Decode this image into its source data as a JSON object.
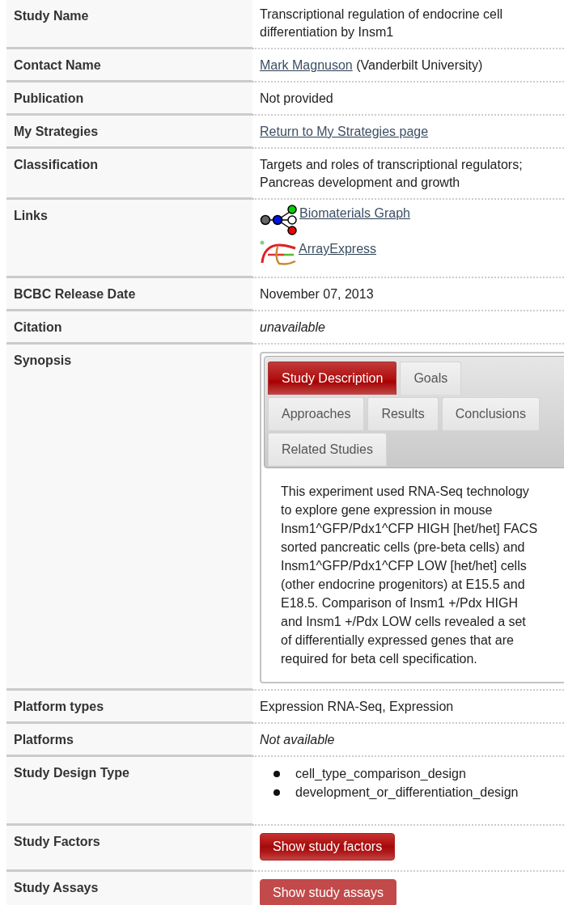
{
  "rows": [
    {
      "label": "Study Name",
      "kind": "text",
      "text": "Transcriptional regulation of endocrine cell differentiation by Insm1"
    },
    {
      "label": "Contact Name",
      "kind": "contact",
      "link": "Mark Magnuson",
      "text": "(Vanderbilt University)"
    },
    {
      "label": "Publication",
      "kind": "text",
      "text": "Not provided"
    },
    {
      "label": "My Strategies",
      "kind": "link",
      "link": "Return to My Strategies page"
    },
    {
      "label": "Classification",
      "kind": "text",
      "text": "Targets and roles of transcriptional regulators; Pancreas development and growth"
    },
    {
      "label": "Links",
      "kind": "links",
      "links": [
        {
          "kind": "graph",
          "text": "Biomaterials Graph"
        },
        {
          "kind": "logo",
          "text": "ArrayExpress"
        }
      ]
    },
    {
      "label": "BCBC Release Date",
      "kind": "text",
      "text": "November 07, 2013"
    },
    {
      "label": "Citation",
      "kind": "italic",
      "text": "unavailable"
    },
    {
      "label": "Synopsis",
      "kind": "synopsis",
      "tabs": [
        {
          "label": "Study Description",
          "selected": true
        },
        {
          "label": "Goals",
          "selected": false
        },
        {
          "label": "Approaches",
          "selected": false
        },
        {
          "label": "Results",
          "selected": false
        },
        {
          "label": "Conclusions",
          "selected": false
        },
        {
          "label": "Related Studies",
          "selected": false
        }
      ],
      "text": "This experiment used RNA-Seq technology to explore gene expression in mouse Insm1^GFP/Pdx1^CFP HIGH [het/het] FACS sorted pancreatic cells (pre-beta cells) and Insm1^GFP/Pdx1^CFP LOW [het/het] cells (other endocrine progenitors) at E15.5 and E18.5. Comparison of Insm1 +/Pdx HIGH and Insm1 +/Pdx LOW cells revealed a set of differentially expressed genes that are required for beta cell specification."
    },
    {
      "label": "Platform types",
      "kind": "text",
      "text": "Expression RNA-Seq, Expression"
    },
    {
      "label": "Platforms",
      "kind": "italic",
      "text": "Not available"
    },
    {
      "label": "Study Design Type",
      "kind": "list",
      "items": [
        "cell_type_comparison_design",
        "development_or_differentiation_design"
      ]
    },
    {
      "label": "Study Factors",
      "kind": "button",
      "button": {
        "label": "Show study factors",
        "highlighted": false
      }
    },
    {
      "label": "Study Assays",
      "kind": "button",
      "button": {
        "label": "Show study assays",
        "highlighted": true
      }
    }
  ]
}
